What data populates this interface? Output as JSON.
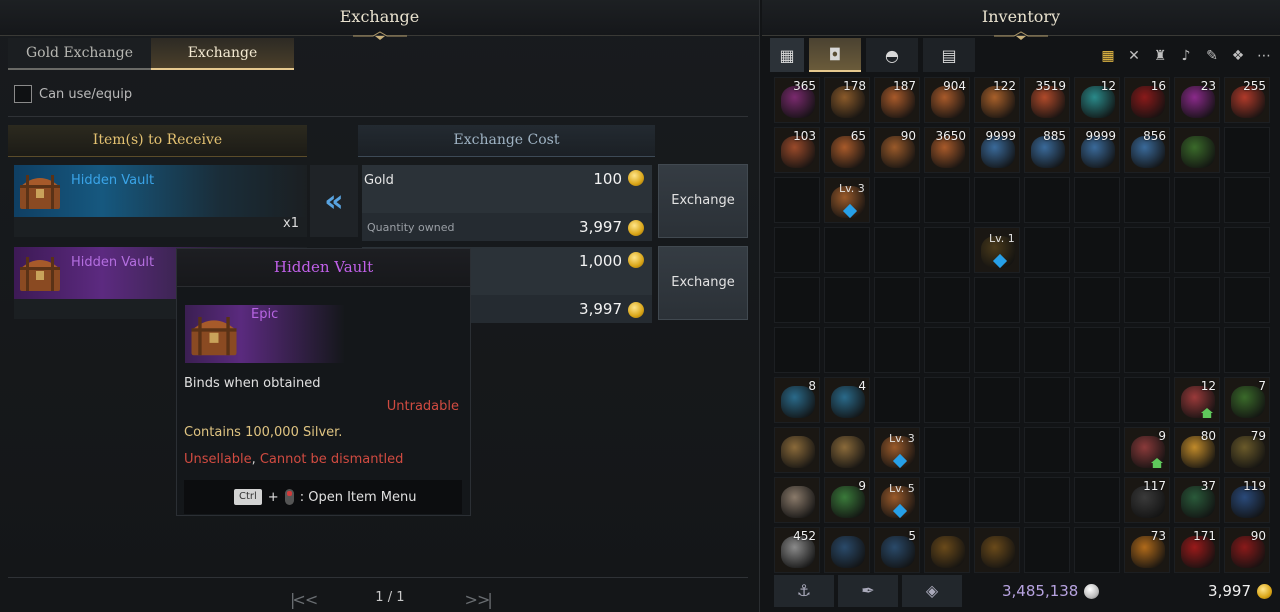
{
  "exchange": {
    "title": "Exchange",
    "tabs": [
      {
        "label": "Gold Exchange",
        "active": false
      },
      {
        "label": "Exchange",
        "active": true
      }
    ],
    "filter_label": "Can use/equip",
    "receive_header": "Item(s) to Receive",
    "cost_header": "Exchange Cost",
    "rows": [
      {
        "item_name": "Hidden Vault",
        "item_color": "#3aa4e8",
        "item_qty": "x1",
        "cost_name": "Gold",
        "cost_value": "100",
        "owned_label": "Quantity owned",
        "owned_value": "3,997",
        "button": "Exchange"
      },
      {
        "item_name": "Hidden Vault",
        "item_color": "#b46ee0",
        "item_qty": "",
        "cost_name": "",
        "cost_value": "1,000",
        "owned_label": "",
        "owned_value": "3,997",
        "button": "Exchange"
      }
    ],
    "pager": {
      "first": "|<",
      "prev": "<",
      "page": "1 / 1",
      "next": ">",
      "last": ">|"
    }
  },
  "tooltip": {
    "title": "Hidden Vault",
    "grade": "Epic",
    "binds": "Binds when obtained",
    "untradable": "Untradable",
    "contains": "Contains 100,000 Silver.",
    "unsellable": "Unsellable",
    "comma": ", ",
    "no_dismantle": "Cannot be dismantled",
    "key": "Ctrl",
    "plus": "+",
    "action": ": Open Item Menu"
  },
  "inventory": {
    "title": "Inventory",
    "slots": [
      {
        "cnt": "365",
        "c": "#7a2a6e"
      },
      {
        "cnt": "178",
        "c": "#8a5a2a"
      },
      {
        "cnt": "187",
        "c": "#a85a2a"
      },
      {
        "cnt": "904",
        "c": "#a85a2a"
      },
      {
        "cnt": "122",
        "c": "#a8602a"
      },
      {
        "cnt": "3519",
        "c": "#b04a2a"
      },
      {
        "cnt": "12",
        "c": "#2a8a8a"
      },
      {
        "cnt": "16",
        "c": "#8a1a1a"
      },
      {
        "cnt": "23",
        "c": "#8a2a8a"
      },
      {
        "cnt": "255",
        "c": "#b03a2a"
      },
      {
        "cnt": "103",
        "c": "#9a4a2a"
      },
      {
        "cnt": "65",
        "c": "#a85a2a"
      },
      {
        "cnt": "90",
        "c": "#9a5a2a"
      },
      {
        "cnt": "3650",
        "c": "#a85a2a"
      },
      {
        "cnt": "9999",
        "c": "#3a6a9a"
      },
      {
        "cnt": "885",
        "c": "#3a6a9a"
      },
      {
        "cnt": "9999",
        "c": "#3a6a9a"
      },
      {
        "cnt": "856",
        "c": "#3a6a9a"
      },
      {
        "cnt": "",
        "c": "#3a6a2a"
      },
      {
        "cnt": "",
        "c": ""
      },
      {
        "cnt": "",
        "c": ""
      },
      {
        "lv": "Lv. 3",
        "c": "#9a5a2a",
        "gem": true
      },
      {
        "cnt": "",
        "c": ""
      },
      {
        "cnt": "",
        "c": ""
      },
      {
        "cnt": "",
        "c": ""
      },
      {
        "cnt": "",
        "c": ""
      },
      {
        "cnt": "",
        "c": ""
      },
      {
        "cnt": "",
        "c": ""
      },
      {
        "cnt": "",
        "c": ""
      },
      {
        "cnt": "",
        "c": ""
      },
      {
        "cnt": "",
        "c": ""
      },
      {
        "cnt": "",
        "c": ""
      },
      {
        "cnt": "",
        "c": ""
      },
      {
        "cnt": "",
        "c": ""
      },
      {
        "lv": "Lv. 1",
        "c": "#4a3a1a",
        "gem": true
      },
      {
        "cnt": "",
        "c": ""
      },
      {
        "cnt": "",
        "c": ""
      },
      {
        "cnt": "",
        "c": ""
      },
      {
        "cnt": "",
        "c": ""
      },
      {
        "cnt": "",
        "c": ""
      },
      {
        "cnt": "",
        "c": ""
      },
      {
        "cnt": "",
        "c": ""
      },
      {
        "cnt": "",
        "c": ""
      },
      {
        "cnt": "",
        "c": ""
      },
      {
        "cnt": "",
        "c": ""
      },
      {
        "cnt": "",
        "c": ""
      },
      {
        "cnt": "",
        "c": ""
      },
      {
        "cnt": "",
        "c": ""
      },
      {
        "cnt": "",
        "c": ""
      },
      {
        "cnt": "",
        "c": ""
      },
      {
        "cnt": "",
        "c": ""
      },
      {
        "cnt": "",
        "c": ""
      },
      {
        "cnt": "",
        "c": ""
      },
      {
        "cnt": "",
        "c": ""
      },
      {
        "cnt": "",
        "c": ""
      },
      {
        "cnt": "",
        "c": ""
      },
      {
        "cnt": "",
        "c": ""
      },
      {
        "cnt": "",
        "c": ""
      },
      {
        "cnt": "",
        "c": ""
      },
      {
        "cnt": "",
        "c": ""
      },
      {
        "cnt": "8",
        "c": "#2a6a8a"
      },
      {
        "cnt": "4",
        "c": "#2a6a8a"
      },
      {
        "cnt": "",
        "c": ""
      },
      {
        "cnt": "",
        "c": ""
      },
      {
        "cnt": "",
        "c": ""
      },
      {
        "cnt": "",
        "c": ""
      },
      {
        "cnt": "",
        "c": ""
      },
      {
        "cnt": "",
        "c": ""
      },
      {
        "cnt": "12",
        "c": "#9a3a3a",
        "home": true
      },
      {
        "cnt": "7",
        "c": "#3a6a2a"
      },
      {
        "cnt": "",
        "c": "#8a6a3a"
      },
      {
        "cnt": "",
        "c": "#8a6a3a"
      },
      {
        "lv": "Lv. 3",
        "c": "#9a5a2a",
        "gem": true
      },
      {
        "cnt": "",
        "c": ""
      },
      {
        "cnt": "",
        "c": ""
      },
      {
        "cnt": "",
        "c": ""
      },
      {
        "cnt": "",
        "c": ""
      },
      {
        "cnt": "9",
        "c": "#8a3a3a",
        "home": true
      },
      {
        "cnt": "80",
        "c": "#c08a2a"
      },
      {
        "cnt": "79",
        "c": "#6a5a2a"
      },
      {
        "cnt": "",
        "c": "#8a7a6a"
      },
      {
        "cnt": "9",
        "c": "#3a7a3a"
      },
      {
        "lv": "Lv. 5",
        "c": "#9a5a2a",
        "gem": true
      },
      {
        "cnt": "",
        "c": ""
      },
      {
        "cnt": "",
        "c": ""
      },
      {
        "cnt": "",
        "c": ""
      },
      {
        "cnt": "",
        "c": ""
      },
      {
        "cnt": "117",
        "c": "#3a3a3a"
      },
      {
        "cnt": "37",
        "c": "#2a5a3a"
      },
      {
        "cnt": "119",
        "c": "#2a4a7a"
      },
      {
        "cnt": "452",
        "c": "#8a8a8a"
      },
      {
        "cnt": "",
        "c": "#2a4a6a"
      },
      {
        "cnt": "5",
        "c": "#2a4a6a"
      },
      {
        "cnt": "",
        "c": "#6a4a1a"
      },
      {
        "cnt": "",
        "c": "#6a4a1a"
      },
      {
        "cnt": "",
        "c": ""
      },
      {
        "cnt": "",
        "c": ""
      },
      {
        "cnt": "73",
        "c": "#b06a1a"
      },
      {
        "cnt": "171",
        "c": "#9a1a1a"
      },
      {
        "cnt": "90",
        "c": "#8a1a1a"
      }
    ],
    "silver": "3,485,138",
    "gold": "3,997"
  }
}
